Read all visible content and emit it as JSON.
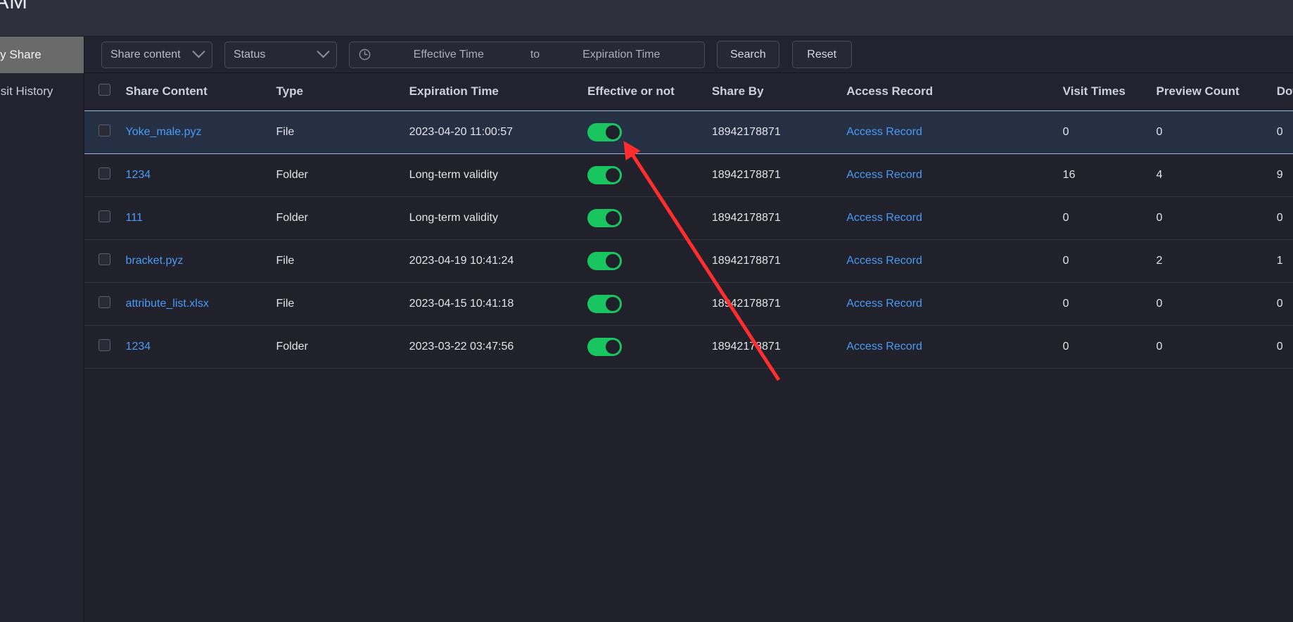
{
  "topbar": {
    "clock_text": "AM"
  },
  "sidebar": {
    "items": [
      {
        "label": "My Share",
        "active": true
      },
      {
        "label": "Visit History",
        "active": false
      }
    ]
  },
  "toolbar": {
    "share_content_select": "Share content",
    "status_select": "Status",
    "effective_time_placeholder": "Effective Time",
    "range_separator": "to",
    "expiration_time_placeholder": "Expiration Time",
    "search_label": "Search",
    "reset_label": "Reset",
    "clock_icon": "clock-icon",
    "chevron_icon": "chevron-down-icon"
  },
  "table": {
    "columns": [
      "",
      "Share Content",
      "Type",
      "Expiration Time",
      "Effective or not",
      "Share By",
      "Access Record",
      "Visit Times",
      "Preview Count",
      "Download Count"
    ],
    "rows": [
      {
        "share_content": "Yoke_male.pyz",
        "type": "File",
        "expiration_time": "2023-04-20 11:00:57",
        "effective": true,
        "share_by": "18942178871",
        "access_record": "Access Record",
        "visit_times": "0",
        "preview_count": "0",
        "download_count": "0",
        "highlighted": true
      },
      {
        "share_content": "1234",
        "type": "Folder",
        "expiration_time": "Long-term validity",
        "effective": true,
        "share_by": "18942178871",
        "access_record": "Access Record",
        "visit_times": "16",
        "preview_count": "4",
        "download_count": "9",
        "highlighted": false
      },
      {
        "share_content": "111",
        "type": "Folder",
        "expiration_time": "Long-term validity",
        "effective": true,
        "share_by": "18942178871",
        "access_record": "Access Record",
        "visit_times": "0",
        "preview_count": "0",
        "download_count": "0",
        "highlighted": false
      },
      {
        "share_content": "bracket.pyz",
        "type": "File",
        "expiration_time": "2023-04-19 10:41:24",
        "effective": true,
        "share_by": "18942178871",
        "access_record": "Access Record",
        "visit_times": "0",
        "preview_count": "2",
        "download_count": "1",
        "highlighted": false
      },
      {
        "share_content": "attribute_list.xlsx",
        "type": "File",
        "expiration_time": "2023-04-15 10:41:18",
        "effective": true,
        "share_by": "18942178871",
        "access_record": "Access Record",
        "visit_times": "0",
        "preview_count": "0",
        "download_count": "0",
        "highlighted": false
      },
      {
        "share_content": "1234",
        "type": "Folder",
        "expiration_time": "2023-03-22 03:47:56",
        "effective": true,
        "share_by": "18942178871",
        "access_record": "Access Record",
        "visit_times": "0",
        "preview_count": "0",
        "download_count": "0",
        "highlighted": false
      }
    ]
  },
  "annotation": {
    "type": "arrow",
    "color": "#ff2d2d",
    "points_to": "effective-toggle-row-1"
  },
  "colors": {
    "page_bg": "#20212b",
    "header_bg": "#2e2f3d",
    "sidebar_active": "#6a6a6a",
    "link": "#4a9bf5",
    "toggle_on": "#18c55f",
    "row_highlight": "#263044",
    "annotation_red": "#ff2d2d"
  }
}
